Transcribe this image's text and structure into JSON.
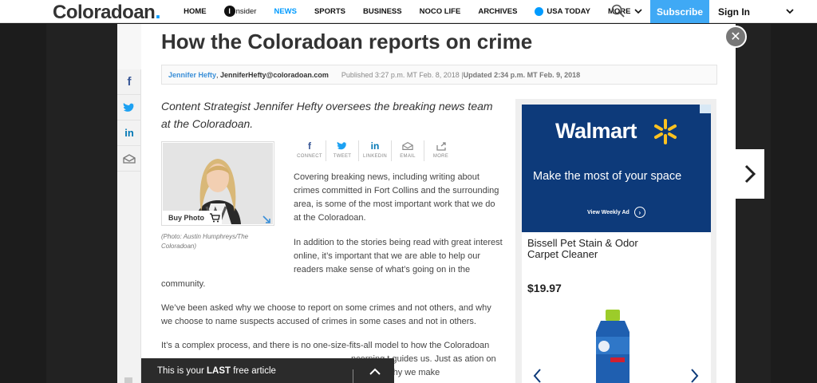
{
  "nav": {
    "logo": "Coloradoan",
    "logo_dot": ".",
    "links": {
      "home": "HOME",
      "insider_mark": "i",
      "insider": "nsider",
      "news": "NEWS",
      "sports": "SPORTS",
      "business": "BUSINESS",
      "noco": "NOCO LIFE",
      "archives": "ARCHIVES",
      "usatoday": "USA TODAY",
      "more": "MORE"
    },
    "subscribe": "Subscribe",
    "signin": "Sign In",
    "accent": "#009bff"
  },
  "article": {
    "headline": "How the Coloradoan reports on crime",
    "close": "✕",
    "byline": {
      "author": "Jennifer Hefty",
      "email": "JenniferHefty@coloradoan.com",
      "published": "Published 3:27 p.m. MT Feb. 8, 2018 | ",
      "updated": "Updated 2:34 p.m. MT Feb. 9, 2018"
    },
    "deck": "Content Strategist Jennifer Hefty oversees the breaking news team at the Coloradoan.",
    "photo": {
      "buy_label": "Buy Photo",
      "caption": "(Photo: Austin Humphreys/The Coloradoan)"
    },
    "share": {
      "connect": "CONNECT",
      "tweet": "TWEET",
      "linkedin": "LINKEDIN",
      "email": "EMAIL",
      "more": "MORE"
    },
    "paragraphs": {
      "p1": "Covering breaking news, including writing about crimes committed in Fort Collins and the surrounding area, is some of the most important work that we do at the Coloradoan.",
      "p2": "In addition to the stories being read with great interest online, it’s important that we are able to help our readers make sense of what’s going on in the",
      "p2b": "community.",
      "p3": "We’ve been asked why we choose to report on some crimes and not others, and why we choose to name suspects accused of crimes in some cases and not in others.",
      "p4": "It’s a complex process, and there is no one-size-fits-all model to how the Coloradoan",
      "p5": "ncerning t guides us. Just as ation on how and why we make"
    }
  },
  "ad": {
    "brand": "Walmart",
    "tagline": "Make the most of your space",
    "cta": "View Weekly Ad",
    "product_name": "Bissell Pet Stain & Odor Carpet Cleaner",
    "price": "$19.97",
    "brand_color": "#0d3a7a"
  },
  "paywall": {
    "prefix": "This is your ",
    "bold": "LAST",
    "suffix": " free article"
  }
}
